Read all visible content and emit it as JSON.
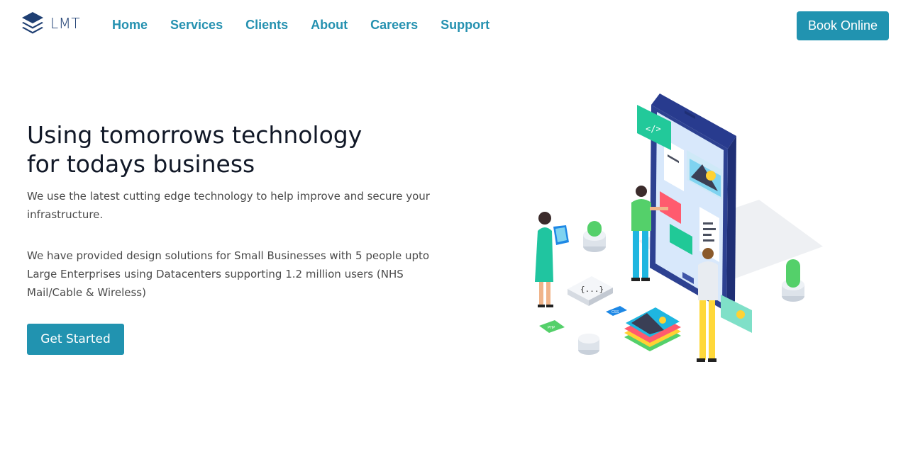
{
  "brand": {
    "name": "LMT",
    "icon": "stacked-layers-logo"
  },
  "nav": {
    "items": [
      {
        "label": "Home"
      },
      {
        "label": "Services"
      },
      {
        "label": "Clients"
      },
      {
        "label": "About"
      },
      {
        "label": "Careers"
      },
      {
        "label": "Support"
      }
    ],
    "cta_label": "Book Online"
  },
  "hero": {
    "title_line1": "Using tomorrows technology",
    "title_line2": "for todays business",
    "paragraph1": "We use the latest cutting edge technology to help improve and secure your infrastructure.",
    "paragraph2": "We have provided design solutions for Small Businesses with 5 people upto Large Enterprises using Datacenters supporting 1.2 million users (NHS Mail/Cable & Wireless)",
    "button_label": "Get Started",
    "illustration": {
      "icon": "isometric-mobile-app-team-illustration",
      "code_badge": "</>",
      "braces_badge": "{...}",
      "css_badge": "CSS",
      "php_badge": "PHP"
    }
  },
  "colors": {
    "primary": "#2193b0",
    "nav_link": "#2591b0",
    "brand": "#1f3f73",
    "heading": "#111827",
    "body_text": "#4a4a4a"
  }
}
